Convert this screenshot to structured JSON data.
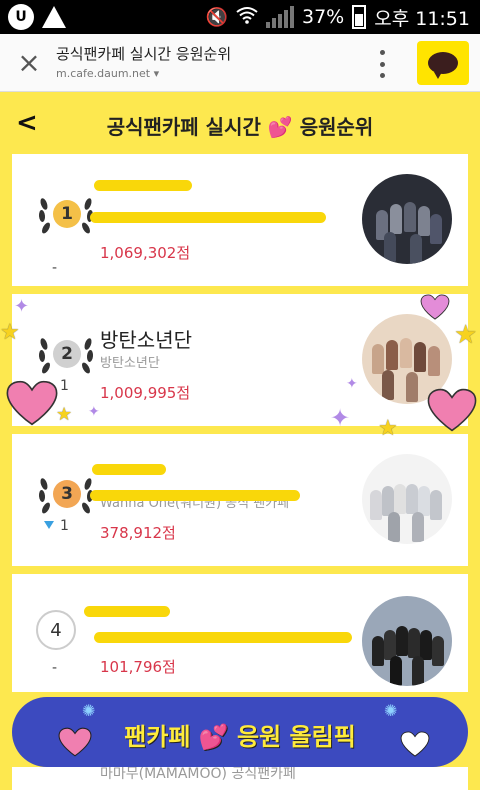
{
  "status": {
    "battery": "37%",
    "time": "오후 11:51"
  },
  "browser": {
    "title": "공식팬카페 실시간 응원순위",
    "url": "m.cafe.daum.net"
  },
  "header": {
    "back_label": "<",
    "title": "공식팬카페 실시간 💕 응원순위"
  },
  "rankings": [
    {
      "rank": "1",
      "name": "",
      "subtitle": "",
      "change": "-",
      "change_dir": "none",
      "score": "1,069,302점",
      "medal_color": "#f4c048"
    },
    {
      "rank": "2",
      "name": "방탄소년단",
      "subtitle": "방탄소년단",
      "change": "1",
      "change_dir": "up",
      "score": "1,009,995점",
      "medal_color": "#d0d0d0"
    },
    {
      "rank": "3",
      "name": "",
      "subtitle": "Wanna One(워너원) 공식 팬카페",
      "change": "1",
      "change_dir": "down",
      "score": "378,912점",
      "medal_color": "#f2a654"
    },
    {
      "rank": "4",
      "name": "",
      "subtitle": "",
      "change": "-",
      "change_dir": "none",
      "score": "101,796점",
      "medal_color": "#ffffff"
    }
  ],
  "peek": {
    "subtitle": "마마무(MAMAMOO) 공식팬카페"
  },
  "banner": {
    "text": "팬카페 💕 응원 올림픽"
  },
  "colors": {
    "background": "#fde84f",
    "score": "#d8364a",
    "banner": "#3c4abf"
  }
}
